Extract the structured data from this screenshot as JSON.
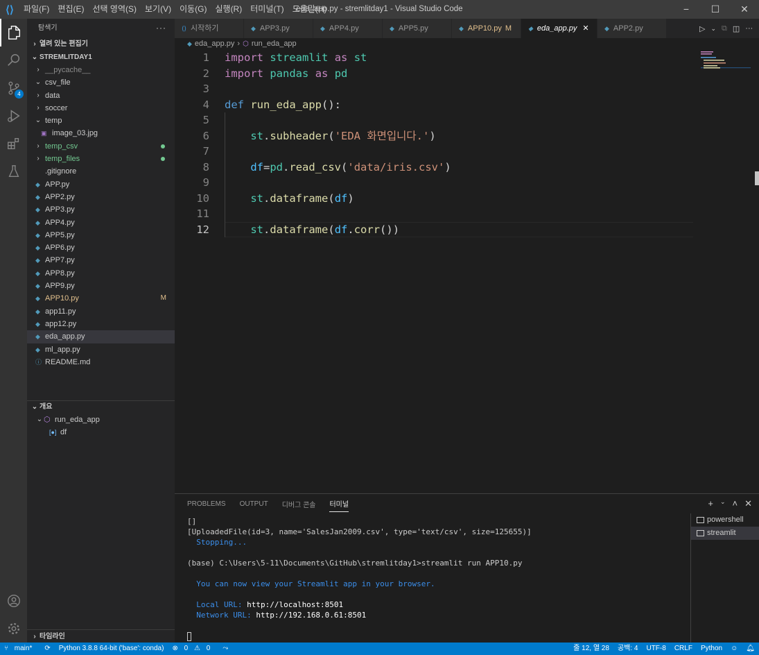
{
  "window": {
    "title": "eda_app.py - stremlitday1 - Visual Studio Code",
    "menu": [
      "파일(F)",
      "편집(E)",
      "선택 영역(S)",
      "보기(V)",
      "이동(G)",
      "실행(R)",
      "터미널(T)",
      "도움말(H)"
    ]
  },
  "activity": {
    "scm_badge": "4"
  },
  "sidebar": {
    "title": "탐색기",
    "open_editors": "열려 있는 편집기",
    "workspace": "STREMLITDAY1",
    "items": [
      {
        "label": "__pycache__",
        "kind": "folder",
        "color": "#8b8b8b"
      },
      {
        "label": "csv_file",
        "kind": "folder-open",
        "color": "#cccccc"
      },
      {
        "label": "data",
        "kind": "folder",
        "color": "#cccccc"
      },
      {
        "label": "soccer",
        "kind": "folder",
        "color": "#cccccc"
      },
      {
        "label": "temp",
        "kind": "folder-open",
        "color": "#cccccc"
      },
      {
        "label": "image_03.jpg",
        "kind": "image",
        "color": "#cccccc"
      },
      {
        "label": "temp_csv",
        "kind": "folder",
        "color": "#73c991"
      },
      {
        "label": "temp_files",
        "kind": "folder",
        "color": "#73c991"
      },
      {
        "label": ".gitignore",
        "kind": "file",
        "color": "#cccccc"
      },
      {
        "label": "APP.py",
        "kind": "py",
        "color": "#cccccc"
      },
      {
        "label": "APP2.py",
        "kind": "py",
        "color": "#cccccc"
      },
      {
        "label": "APP3.py",
        "kind": "py",
        "color": "#cccccc"
      },
      {
        "label": "APP4.py",
        "kind": "py",
        "color": "#cccccc"
      },
      {
        "label": "APP5.py",
        "kind": "py",
        "color": "#cccccc"
      },
      {
        "label": "APP6.py",
        "kind": "py",
        "color": "#cccccc"
      },
      {
        "label": "APP7.py",
        "kind": "py",
        "color": "#cccccc"
      },
      {
        "label": "APP8.py",
        "kind": "py",
        "color": "#cccccc"
      },
      {
        "label": "APP9.py",
        "kind": "py",
        "color": "#cccccc"
      },
      {
        "label": "APP10.py",
        "kind": "py",
        "color": "#e2c08d",
        "mark": "M"
      },
      {
        "label": "app11.py",
        "kind": "py",
        "color": "#cccccc"
      },
      {
        "label": "app12.py",
        "kind": "py",
        "color": "#cccccc"
      },
      {
        "label": "eda_app.py",
        "kind": "py",
        "color": "#cccccc",
        "selected": true
      },
      {
        "label": "ml_app.py",
        "kind": "py",
        "color": "#cccccc"
      },
      {
        "label": "README.md",
        "kind": "md",
        "color": "#cccccc"
      }
    ],
    "outline": "개요",
    "outline_items": [
      "run_eda_app",
      "df"
    ],
    "timeline": "타임라인"
  },
  "tabs": [
    {
      "label": "시작하기",
      "kind": "welcome"
    },
    {
      "label": "APP3.py"
    },
    {
      "label": "APP4.py"
    },
    {
      "label": "APP5.py"
    },
    {
      "label": "APP10.py",
      "modified": "M"
    },
    {
      "label": "eda_app.py",
      "active": true,
      "close": "✕"
    },
    {
      "label": "APP2.py"
    }
  ],
  "breadcrumb": [
    "eda_app.py",
    "run_eda_app"
  ],
  "code": {
    "current_line": 12,
    "lines": [
      [
        [
          "import",
          "kw"
        ],
        [
          " ",
          "pl"
        ],
        [
          "streamlit",
          "mod"
        ],
        [
          " ",
          "pl"
        ],
        [
          "as",
          "kw"
        ],
        [
          " ",
          "pl"
        ],
        [
          "st",
          "mod"
        ]
      ],
      [
        [
          "import",
          "kw"
        ],
        [
          " ",
          "pl"
        ],
        [
          "pandas",
          "mod"
        ],
        [
          " ",
          "pl"
        ],
        [
          "as",
          "kw"
        ],
        [
          " ",
          "pl"
        ],
        [
          "pd",
          "mod"
        ]
      ],
      [],
      [
        [
          "def",
          "kw2"
        ],
        [
          " ",
          "pl"
        ],
        [
          "run_eda_app",
          "fn"
        ],
        [
          "():",
          "pl"
        ]
      ],
      [],
      [
        [
          "    ",
          "pl"
        ],
        [
          "st",
          "mod"
        ],
        [
          ".",
          "pl"
        ],
        [
          "subheader",
          "fn"
        ],
        [
          "(",
          "pl"
        ],
        [
          "'EDA 화면입니다.'",
          "str"
        ],
        [
          ")",
          "pl"
        ]
      ],
      [],
      [
        [
          "    ",
          "pl"
        ],
        [
          "df",
          "var"
        ],
        [
          "=",
          "pl"
        ],
        [
          "pd",
          "mod"
        ],
        [
          ".",
          "pl"
        ],
        [
          "read_csv",
          "fn"
        ],
        [
          "(",
          "pl"
        ],
        [
          "'data/iris.csv'",
          "str"
        ],
        [
          ")",
          "pl"
        ]
      ],
      [],
      [
        [
          "    ",
          "pl"
        ],
        [
          "st",
          "mod"
        ],
        [
          ".",
          "pl"
        ],
        [
          "dataframe",
          "fn"
        ],
        [
          "(",
          "pl"
        ],
        [
          "df",
          "var"
        ],
        [
          ")",
          "pl"
        ]
      ],
      [],
      [
        [
          "    ",
          "pl"
        ],
        [
          "st",
          "mod"
        ],
        [
          ".",
          "pl"
        ],
        [
          "dataframe",
          "fn"
        ],
        [
          "(",
          "pl"
        ],
        [
          "df",
          "var"
        ],
        [
          ".",
          "pl"
        ],
        [
          "corr",
          "fn"
        ],
        [
          "())",
          "pl"
        ]
      ]
    ]
  },
  "panel": {
    "tabs": [
      "PROBLEMS",
      "OUTPUT",
      "디버그 콘솔",
      "터미널"
    ],
    "active_tab": "터미널",
    "terminal_lines": [
      {
        "text": "[]",
        "style": ""
      },
      {
        "text": "[UploadedFile(id=3, name='SalesJan2009.csv', type='text/csv', size=125655)]",
        "style": ""
      },
      {
        "text": "  Stopping...",
        "style": "blue"
      },
      {
        "text": "",
        "style": ""
      },
      {
        "text": "(base) C:\\Users\\5-11\\Documents\\GitHub\\stremlitday1>streamlit run APP10.py",
        "style": ""
      },
      {
        "text": "",
        "style": ""
      },
      {
        "text": "  You can now view your Streamlit app in your browser.",
        "style": "blue"
      },
      {
        "text": "",
        "style": ""
      },
      {
        "text": "  Local URL: ",
        "style": "blue",
        "strong": "http://localhost:8501"
      },
      {
        "text": "  Network URL: ",
        "style": "blue",
        "strong": "http://192.168.0.61:8501"
      },
      {
        "text": "",
        "style": ""
      }
    ],
    "terminals": [
      {
        "label": "powershell",
        "selected": false
      },
      {
        "label": "streamlit",
        "selected": true
      }
    ]
  },
  "status": {
    "branch": "main*",
    "python": "Python 3.8.8 64-bit ('base': conda)",
    "errors": "0",
    "warnings": "0",
    "position": "줄 12, 열 28",
    "spaces": "공백: 4",
    "encoding": "UTF-8",
    "eol": "CRLF",
    "language": "Python"
  }
}
